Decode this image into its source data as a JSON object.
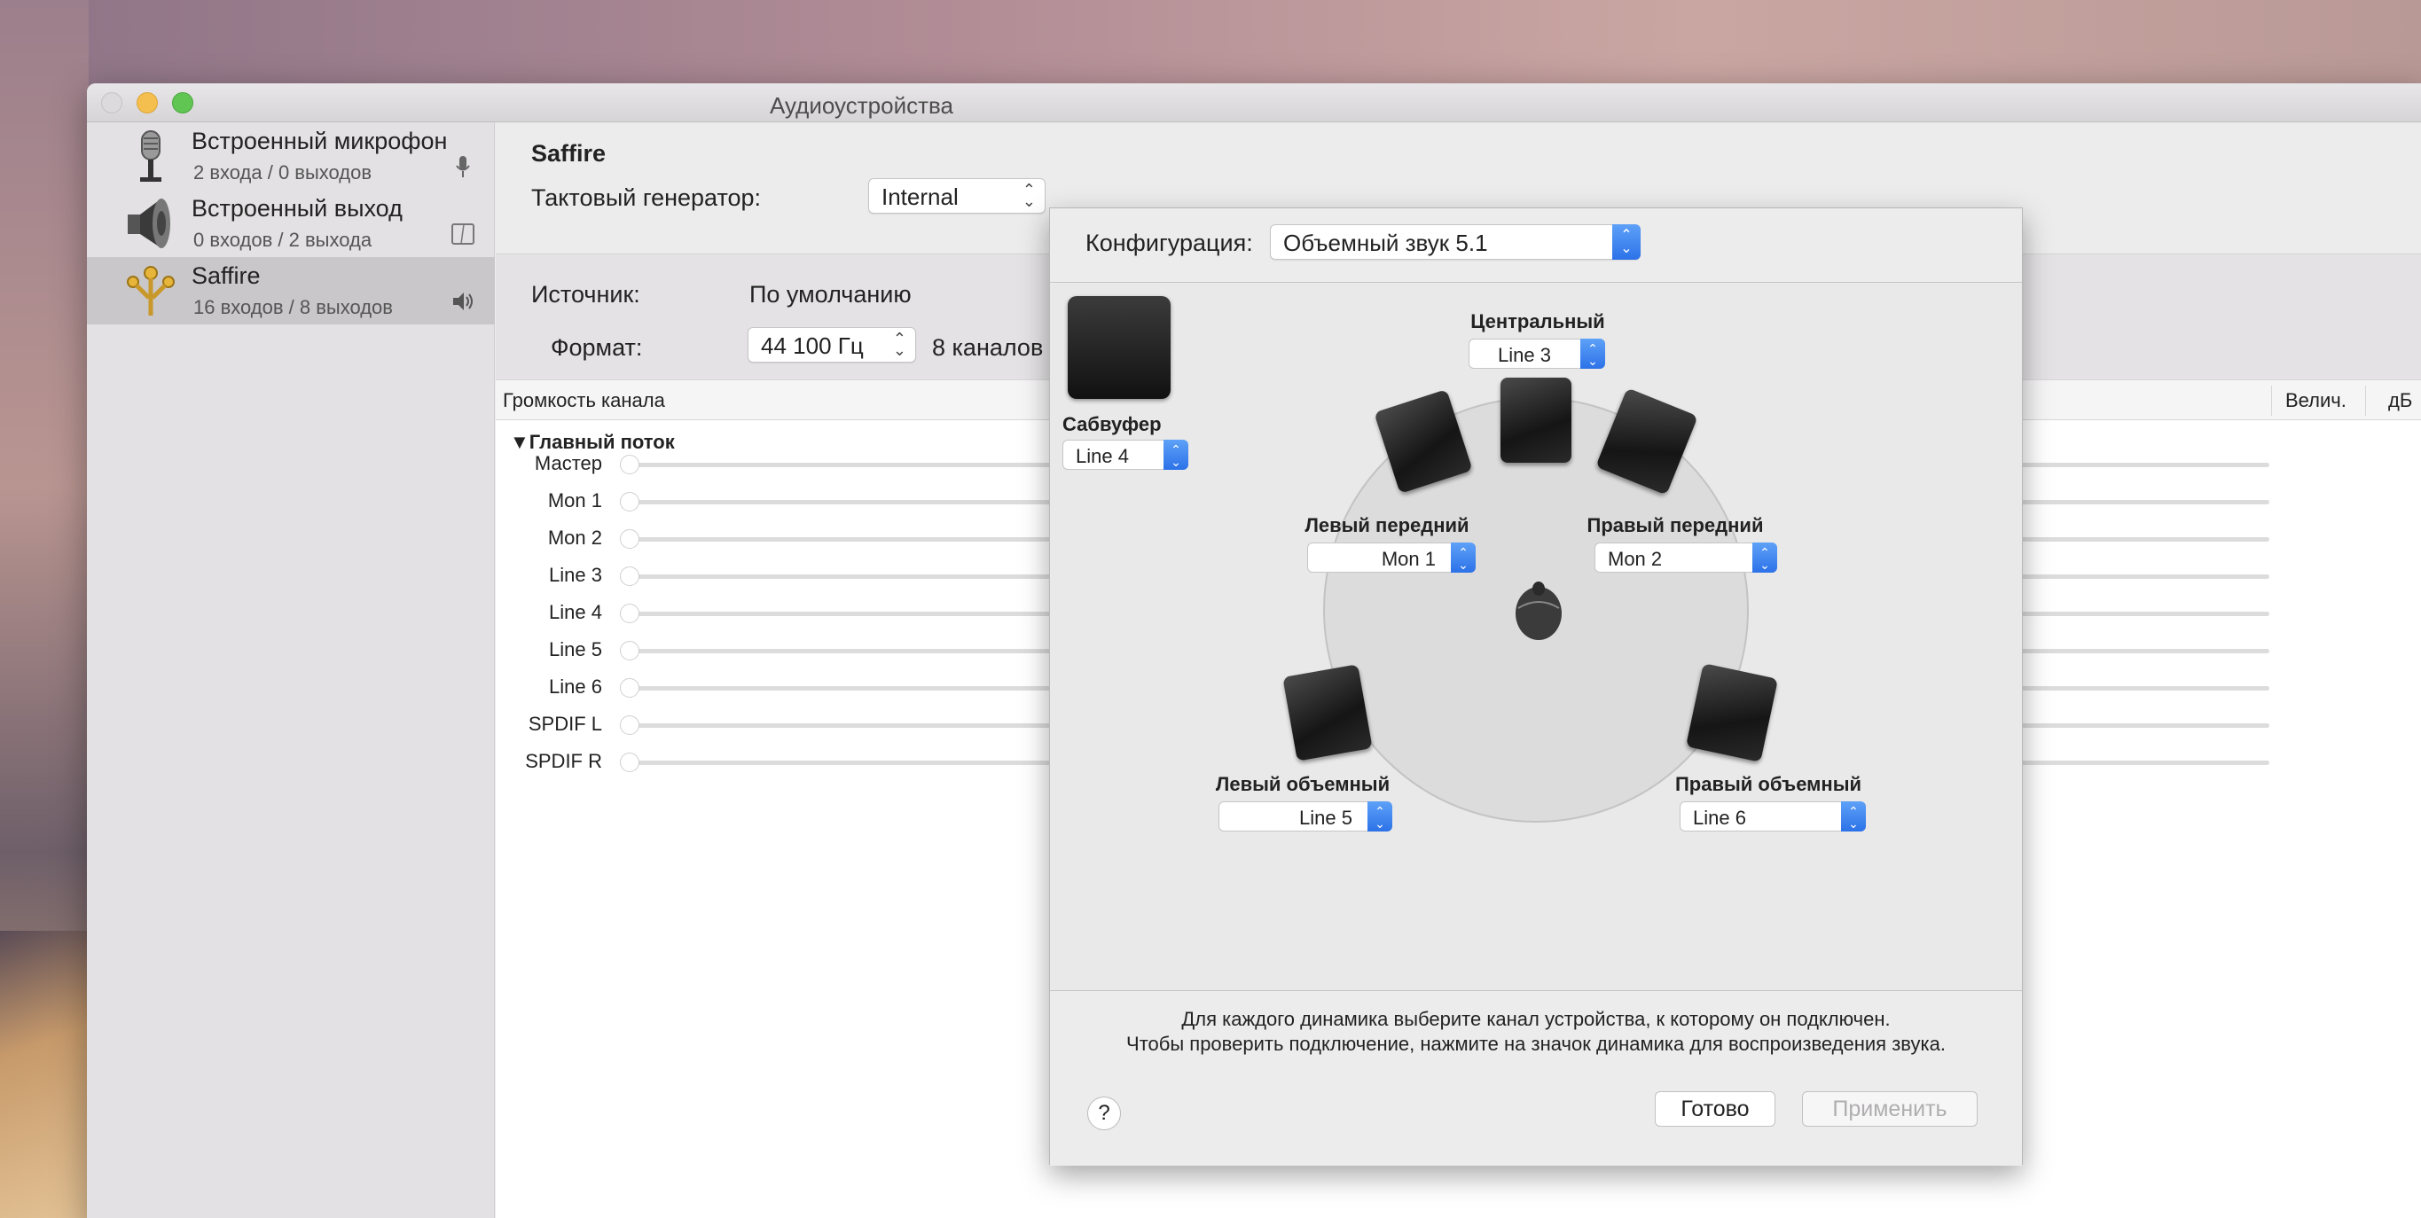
{
  "window": {
    "title": "Аудиоустройства"
  },
  "devices": [
    {
      "name": "Встроенный микрофон",
      "sub": "2 входа / 0 выходов",
      "side_icon": "microphone-icon"
    },
    {
      "name": "Встроенный выход",
      "sub": "0 входов / 2 выхода",
      "side_icon": "finder-icon"
    },
    {
      "name": "Saffire",
      "sub": "16 входов / 8 выходов",
      "side_icon": "speaker-icon",
      "selected": true
    }
  ],
  "main": {
    "device_title": "Saffire",
    "clock_label": "Тактовый генератор:",
    "clock_value": "Internal",
    "source_label": "Источник:",
    "source_value": "По умолчанию",
    "format_label": "Формат:",
    "format_value": "44 100 Гц",
    "format_channels": "8 каналов",
    "table": {
      "col_volume": "Громкость канала",
      "col_value": "Велич.",
      "col_db": "дБ",
      "group": "Главный поток",
      "rows": [
        "Мастер",
        "Mon 1",
        "Mon 2",
        "Line 3",
        "Line 4",
        "Line 5",
        "Line 6",
        "SPDIF L",
        "SPDIF R"
      ]
    }
  },
  "sheet": {
    "config_label": "Конфигурация:",
    "config_value": "Объемный звук 5.1",
    "subwoofer": {
      "name": "Сабвуфер",
      "channel": "Line 4"
    },
    "center": {
      "name": "Центральный",
      "channel": "Line 3"
    },
    "front_left": {
      "name": "Левый передний",
      "channel": "Mon 1"
    },
    "front_right": {
      "name": "Правый передний",
      "channel": "Mon 2"
    },
    "surround_left": {
      "name": "Левый объемный",
      "channel": "Line 5"
    },
    "surround_right": {
      "name": "Правый объемный",
      "channel": "Line 6"
    },
    "hint_line1": "Для каждого динамика выберите канал устройства, к которому он подключен.",
    "hint_line2": "Чтобы проверить подключение, нажмите на значок динамика для воспроизведения звука.",
    "help": "?",
    "done_button": "Готово",
    "apply_button": "Применить"
  },
  "colors": {
    "accent": "#2c72e8",
    "selected_row": "#c9c7c9"
  }
}
